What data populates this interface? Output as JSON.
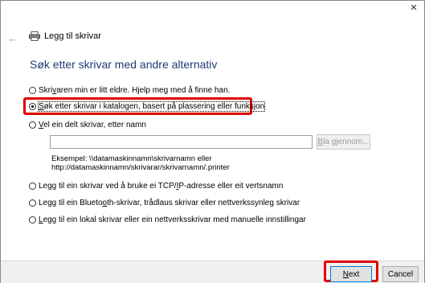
{
  "window": {
    "close_glyph": "×"
  },
  "header": {
    "back_glyph": "←",
    "title": "Legg til skrivar"
  },
  "main": {
    "heading": "Søk etter skrivar med andre alternativ",
    "options": [
      {
        "pre": "Skri",
        "u": "v",
        "post": "aren min er litt eldre. Hjelp meg med å finne han.",
        "checked": false
      },
      {
        "pre": "",
        "u": "S",
        "post": "øk etter skrivar i katalogen, basert på plassering eller funksjon",
        "checked": true
      },
      {
        "pre": "",
        "u": "V",
        "post": "el ein delt skrivar, etter namn",
        "checked": false
      },
      {
        "pre": "Legg til ein skrivar ved å bruke ei TCP/",
        "u": "I",
        "post": "P-adresse eller eit vertsnamn",
        "checked": false
      },
      {
        "pre": "Legg til ein Blueto",
        "u": "o",
        "post": "th-skrivar, trådlaus skrivar eller nettverkssynleg skrivar",
        "checked": false
      },
      {
        "pre": "",
        "u": "L",
        "post": "egg til ein lokal skrivar eller ein nettverksskrivar med manuelle innstillingar",
        "checked": false
      }
    ],
    "shared_input_value": "",
    "browse": {
      "u": "B",
      "post": "la gjennom..."
    },
    "example_line1": "Eksempel: \\\\datamaskinnamn\\skrivarnamn eller",
    "example_line2": "http://datamaskinnamn/skrivarar/skrivarnamn/.printer"
  },
  "footer": {
    "next": {
      "u": "N",
      "post": "ext"
    },
    "cancel_label": "Cancel"
  },
  "colors": {
    "heading": "#1f3b73",
    "highlight": "#e00000",
    "default_button_border": "#0078d7"
  }
}
